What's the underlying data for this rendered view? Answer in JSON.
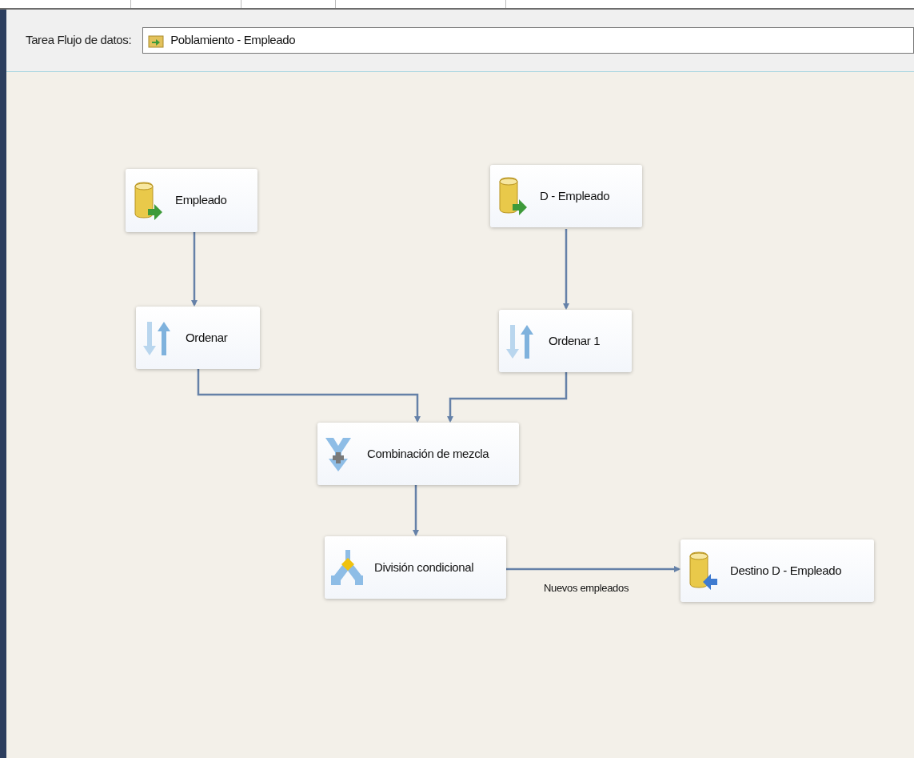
{
  "header": {
    "label": "Tarea Flujo de datos:",
    "task": {
      "value": "Poblamiento - Empleado"
    }
  },
  "nodes": [
    {
      "kind": "source",
      "label": "Empleado"
    },
    {
      "kind": "source",
      "label": "D - Empleado"
    },
    {
      "kind": "sort",
      "label": "Ordenar"
    },
    {
      "kind": "sort",
      "label": "Ordenar 1"
    },
    {
      "kind": "merge",
      "label": "Combinación de mezcla"
    },
    {
      "kind": "split",
      "label": "División condicional"
    },
    {
      "kind": "destination",
      "label": "Destino D - Empleado"
    }
  ],
  "connector_label": "Nuevos empleados"
}
